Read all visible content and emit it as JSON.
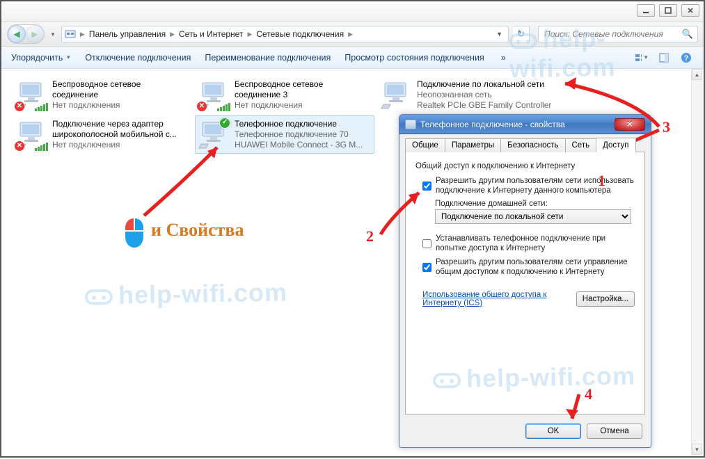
{
  "breadcrumb": {
    "root": "Панель управления",
    "mid": "Сеть и Интернет",
    "leaf": "Сетевые подключения"
  },
  "search": {
    "placeholder": "Поиск: Сетевые подключения"
  },
  "toolbar": {
    "organize": "Упорядочить",
    "disable": "Отключение подключения",
    "rename": "Переименование подключения",
    "status": "Просмотр состояния подключения"
  },
  "connections": [
    {
      "name": "Беспроводное сетевое соединение",
      "status": "Нет подключения",
      "device": "",
      "disabled": true,
      "wifi": true
    },
    {
      "name": "Беспроводное сетевое соединение 3",
      "status": "Нет подключения",
      "device": "",
      "disabled": true,
      "wifi": true
    },
    {
      "name": "Подключение по локальной сети",
      "status": "Неопознанная сеть",
      "device": "Realtek PCIe GBE Family Controller",
      "disabled": false,
      "wifi": false
    },
    {
      "name": "Подключение через адаптер широкополосной мобильной с...",
      "status": "Нет подключения",
      "device": "",
      "disabled": true,
      "wifi": true
    },
    {
      "name": "Телефонное подключение",
      "status": "Телефонное подключение 70",
      "device": "HUAWEI Mobile Connect - 3G M...",
      "disabled": false,
      "wifi": false,
      "selected": true,
      "connected": true
    }
  ],
  "dialog": {
    "title": "Телефонное подключение - свойства",
    "tabs": {
      "general": "Общие",
      "options": "Параметры",
      "security": "Безопасность",
      "network": "Сеть",
      "sharing": "Доступ"
    },
    "sharing": {
      "group": "Общий доступ к подключению к Интернету",
      "allow_label": "Разрешить другим пользователям сети использовать подключение к Интернету данного компьютера",
      "homenet_label": "Подключение домашней сети:",
      "homenet_value": "Подключение по локальной сети",
      "dial_label": "Устанавливать телефонное подключение при попытке доступа к Интернету",
      "control_label": "Разрешить другим пользователям сети управление общим доступом к подключению к Интернету",
      "link": "Использование общего доступа к Интернету (ICS)",
      "settings_btn": "Настройка..."
    },
    "buttons": {
      "ok": "OK",
      "cancel": "Отмена"
    }
  },
  "annotations": {
    "mouse_label": "и Свойства",
    "n1": "1",
    "n2": "2",
    "n3": "3",
    "n4": "4"
  },
  "watermark": "help-wifi.com"
}
